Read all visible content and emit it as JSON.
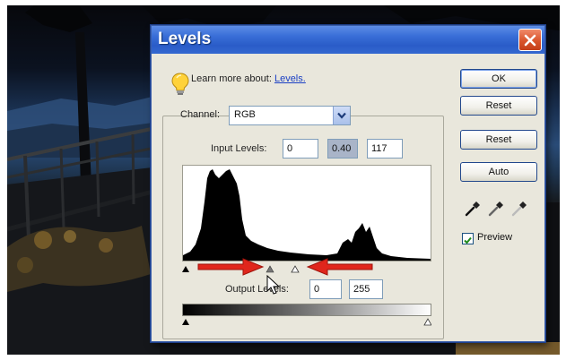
{
  "dialog": {
    "title": "Levels",
    "learn_more_prefix": "Learn more about:",
    "learn_more_link": "Levels.",
    "channel_label": "Channel:",
    "channel_value": "RGB",
    "input_levels_label": "Input Levels:",
    "input_levels": [
      "0",
      "0.40",
      "117"
    ],
    "output_levels_label": "Output Levels:",
    "output_levels": [
      "0",
      "255"
    ],
    "preview_label": "Preview",
    "preview_checked": true
  },
  "buttons": {
    "ok": "OK",
    "reset_1": "Reset",
    "reset_2": "Reset",
    "auto": "Auto"
  },
  "icons": {
    "bulb": "lightbulb-icon",
    "close": "close-icon",
    "eyedroppers": [
      "black-eyedropper-icon",
      "gray-eyedropper-icon",
      "white-eyedropper-icon"
    ]
  },
  "colors": {
    "titlebar": "#2a5cc8",
    "close": "#d9542c",
    "annotation_arrow": "#e0261c",
    "link": "#1a3fc4"
  }
}
